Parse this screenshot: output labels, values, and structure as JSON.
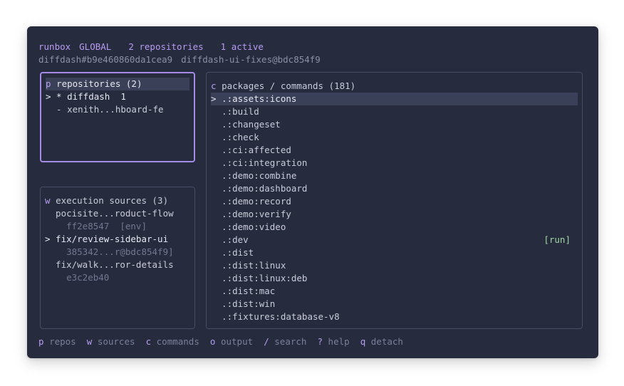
{
  "header": {
    "app": "runbox",
    "scope": "GLOBAL",
    "repos_count": "2 repositories",
    "active": "1 active",
    "ref1": "diffdash#b9e460860da1cea9",
    "ref2": "diffdash-ui-fixes@bdc854f9"
  },
  "repos": {
    "key": "p",
    "title": "repositories (2)",
    "items": [
      {
        "text": "> * diffdash  1"
      },
      {
        "text": "  - xenith...hboard-fe"
      }
    ]
  },
  "sources": {
    "key": "w",
    "title": "execution sources (3)",
    "items": [
      {
        "text": "  pocisite...roduct-flow"
      },
      {
        "text": "    ff2e8547  [env]"
      },
      {
        "text": "> fix/review-sidebar-ui"
      },
      {
        "text": "    385342...r@bdc854f9]"
      },
      {
        "text": "  fix/walk...ror-details"
      },
      {
        "text": "    e3c2eb40"
      }
    ]
  },
  "commands": {
    "key": "c",
    "title": "packages / commands (181)",
    "items": [
      {
        "text": "> .:assets:icons"
      },
      {
        "text": "  .:build"
      },
      {
        "text": "  .:changeset"
      },
      {
        "text": "  .:check"
      },
      {
        "text": "  .:ci:affected"
      },
      {
        "text": "  .:ci:integration"
      },
      {
        "text": "  .:demo:combine"
      },
      {
        "text": "  .:demo:dashboard"
      },
      {
        "text": "  .:demo:record"
      },
      {
        "text": "  .:demo:verify"
      },
      {
        "text": "  .:demo:video"
      },
      {
        "text": "  .:dev"
      },
      {
        "text": "  .:dist"
      },
      {
        "text": "  .:dist:linux"
      },
      {
        "text": "  .:dist:linux:deb"
      },
      {
        "text": "  .:dist:mac"
      },
      {
        "text": "  .:dist:win"
      },
      {
        "text": "  .:fixtures:database-v8"
      }
    ],
    "run_label": "[run]"
  },
  "footer": [
    {
      "key": "p",
      "label": "repos"
    },
    {
      "key": "w",
      "label": "sources"
    },
    {
      "key": "c",
      "label": "commands"
    },
    {
      "key": "o",
      "label": "output"
    },
    {
      "key": "/",
      "label": "search"
    },
    {
      "key": "?",
      "label": "help"
    },
    {
      "key": "q",
      "label": "detach"
    }
  ],
  "colors": {
    "background": "#262b3d",
    "accent": "#b79cf3",
    "run": "#9fd7a6"
  }
}
